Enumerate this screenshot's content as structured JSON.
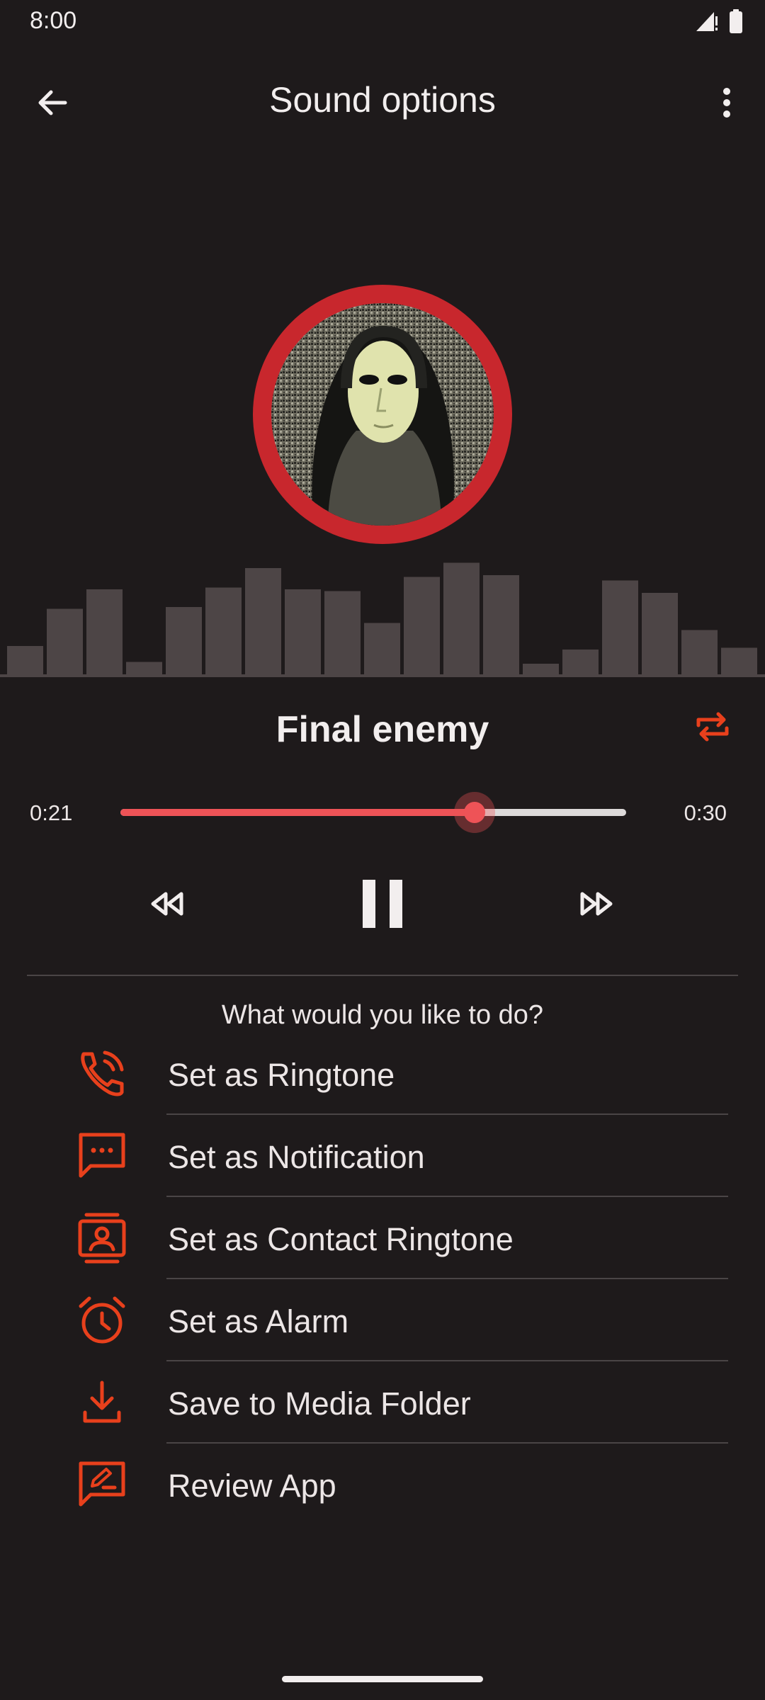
{
  "status_bar": {
    "time": "8:00",
    "icons": [
      "signal-icon",
      "battery-icon"
    ]
  },
  "app_bar": {
    "title": "Sound options",
    "back_icon": "arrow-left-icon",
    "menu_icon": "more-vert-icon"
  },
  "track": {
    "title": "Final enemy",
    "time_current": "0:21",
    "time_total": "0:30",
    "progress": 0.7
  },
  "visualizer": {
    "levels": [
      0.16,
      0.37,
      0.48,
      0.07,
      0.38,
      0.49,
      0.6,
      0.48,
      0.47,
      0.29,
      0.55,
      0.63,
      0.56,
      0.06,
      0.14,
      0.53,
      0.46,
      0.25,
      0.15
    ]
  },
  "question": "What would you like to do?",
  "actions": [
    {
      "label": "Set as Ringtone",
      "icon": "phone-ring-icon"
    },
    {
      "label": "Set as Notification",
      "icon": "message-dots-icon"
    },
    {
      "label": "Set as Contact Ringtone",
      "icon": "contact-card-icon"
    },
    {
      "label": "Set as Alarm",
      "icon": "alarm-clock-icon"
    },
    {
      "label": "Save to Media Folder",
      "icon": "download-icon"
    },
    {
      "label": "Review App",
      "icon": "rate-review-icon"
    }
  ],
  "colors": {
    "background": "#1e1a1b",
    "accent": "#e8401c",
    "ring": "#c8272d",
    "seek": "#ee5357",
    "bars": "#4d4546"
  }
}
